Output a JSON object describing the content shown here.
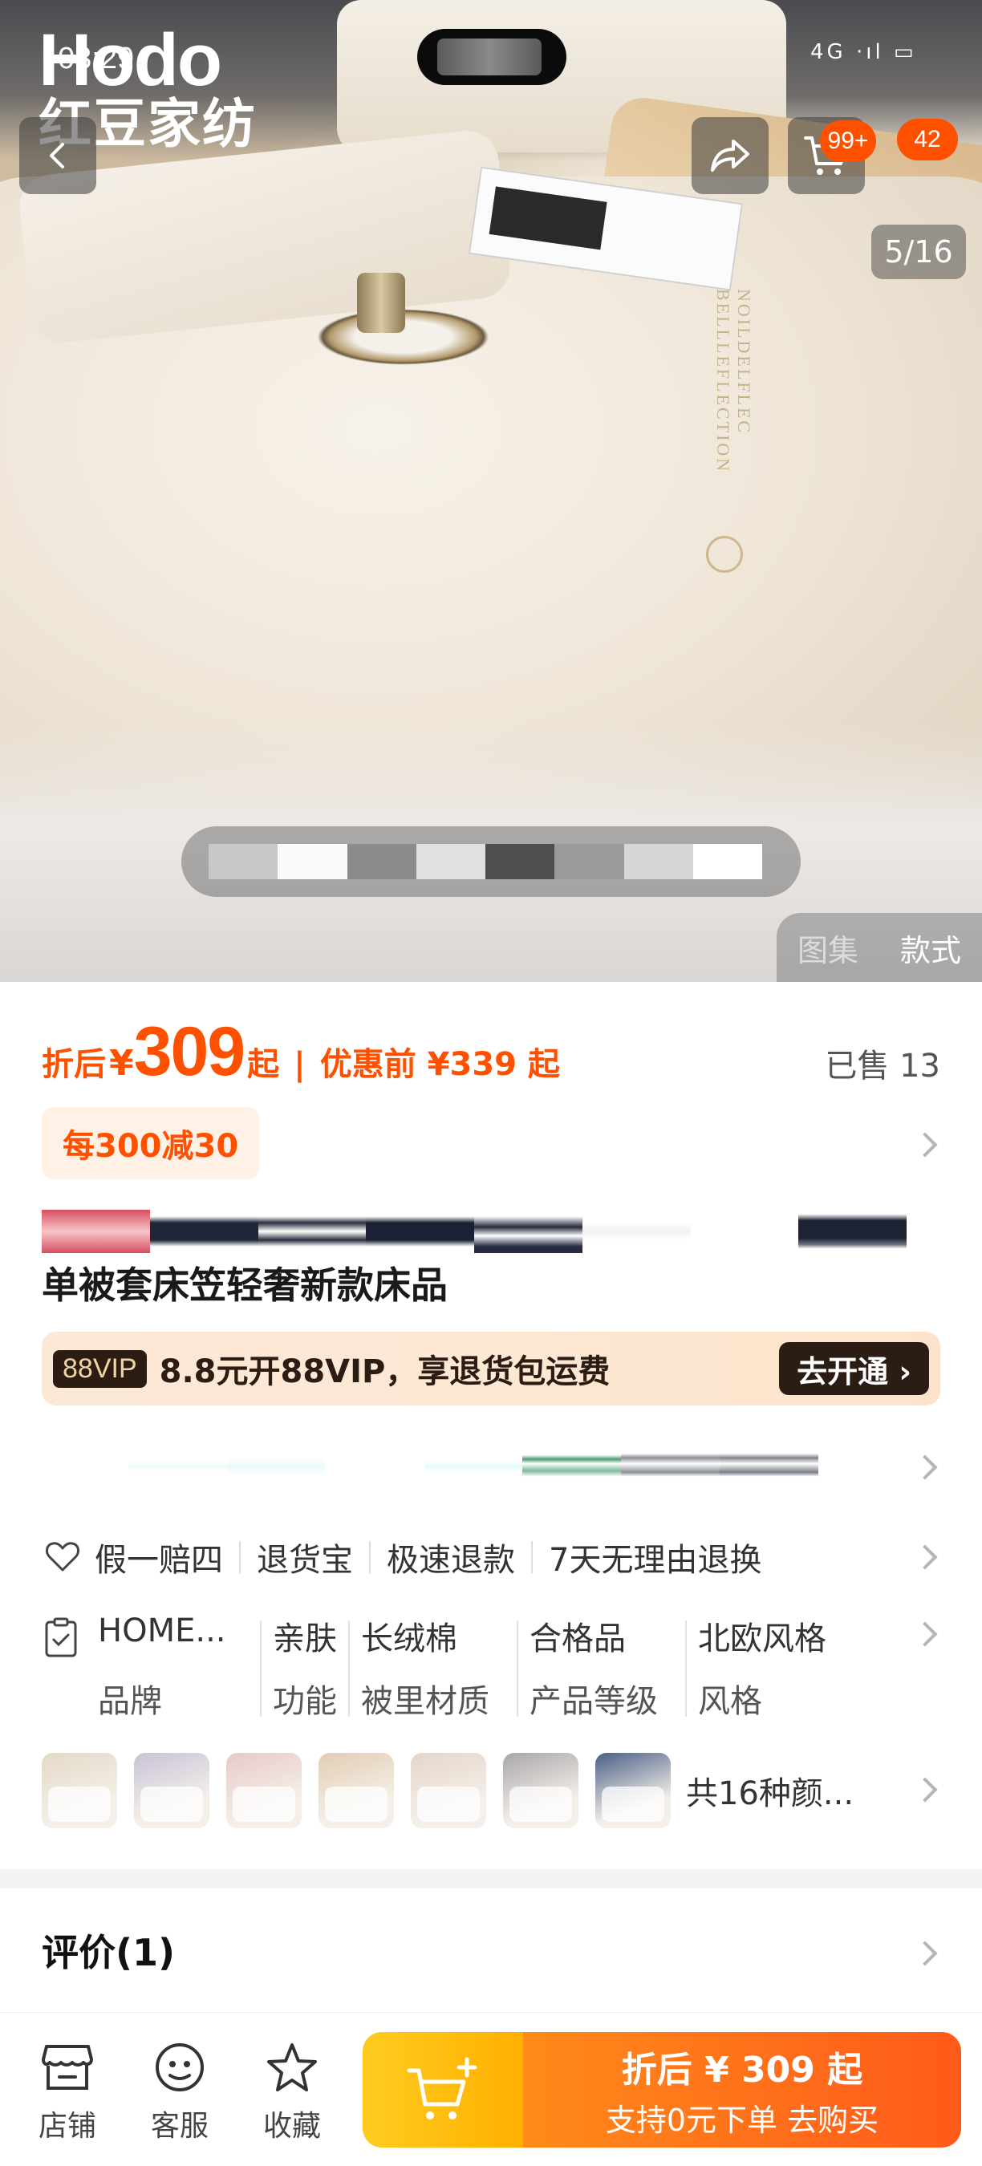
{
  "status_bar": {
    "time": "03:29",
    "signal": "4G ·ıl",
    "battery": "▭"
  },
  "brand": {
    "latin": "Hodo",
    "cn": "红豆家纺"
  },
  "hero": {
    "embroidery": "NOILDELFLEC BELLLEFLECTION",
    "page_indicator": "5/16",
    "cart_badge": "99+",
    "message_badge": "42",
    "view_gallery": "图集",
    "view_style": "款式"
  },
  "price": {
    "prefix": "折后",
    "yen": "¥",
    "amount": "309",
    "suffix": "起",
    "separator": "|",
    "original_label": "优惠前 ¥339 起",
    "sold": "已售 13"
  },
  "coupon": {
    "label": "每300减30"
  },
  "title": {
    "text": "单被套床笠轻奢新款床品"
  },
  "vip": {
    "tag": "88VIP",
    "text": "8.8元开88VIP，享退货包运费",
    "button": "去开通 ›"
  },
  "services": [
    "假一赔四",
    "退货宝",
    "极速退款",
    "7天无理由退换"
  ],
  "attributes": [
    {
      "value": "HOME...",
      "key": "品牌"
    },
    {
      "value": "亲肤",
      "key": "功能"
    },
    {
      "value": "长绒棉",
      "key": "被里材质"
    },
    {
      "value": "合格品",
      "key": "产品等级"
    },
    {
      "value": "北欧风格",
      "key": "风格"
    }
  ],
  "swatches": {
    "colors": [
      "#e4d9c8",
      "#c9c2d8",
      "#e8c9c8",
      "#e2cdb3",
      "#e6d5c8",
      "#a9a6aa",
      "#4a5f86"
    ],
    "more_label": "共16种颜..."
  },
  "reviews": {
    "label": "评价(1)"
  },
  "bottom_bar": {
    "store": "店铺",
    "service": "客服",
    "favorite": "收藏",
    "buy_line1": "折后 ¥ 309 起",
    "buy_line2": "支持0元下单  去购买"
  }
}
